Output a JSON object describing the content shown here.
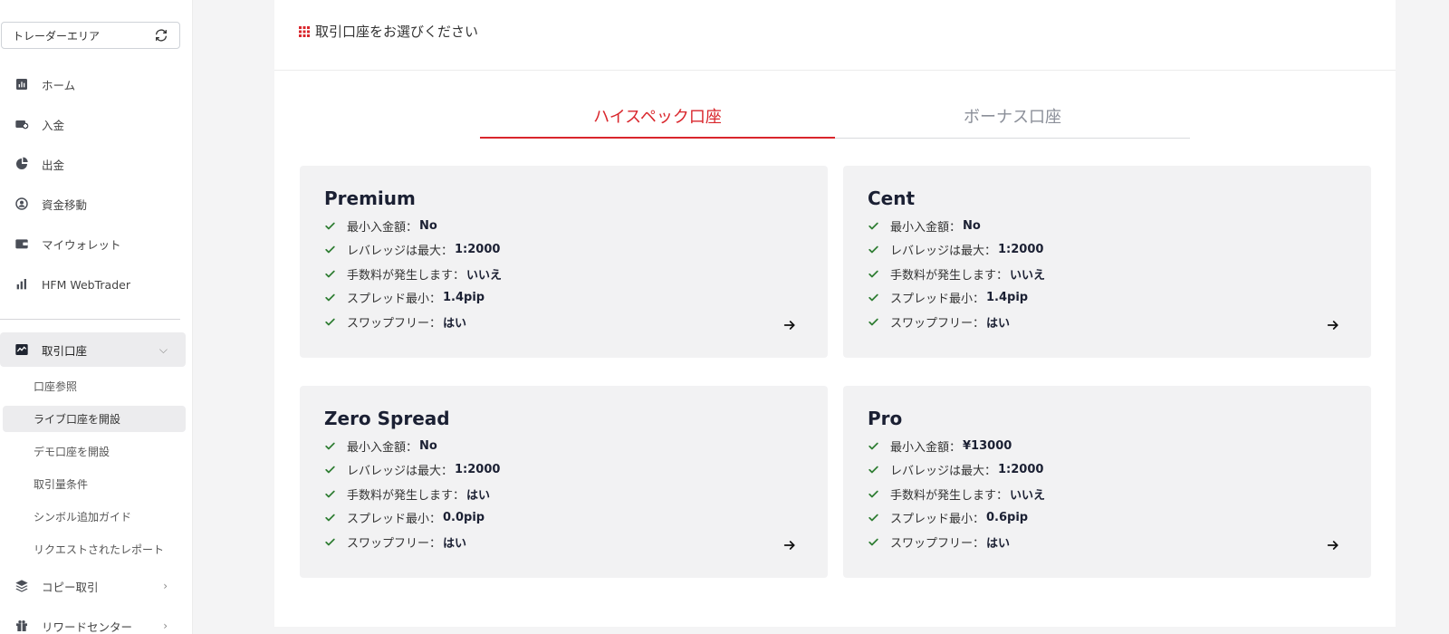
{
  "sidebar": {
    "area_label": "トレーダーエリア",
    "nav": [
      {
        "label": "ホーム",
        "icon": "chart-icon"
      },
      {
        "label": "入金",
        "icon": "deposit-icon"
      },
      {
        "label": "出金",
        "icon": "withdraw-icon"
      },
      {
        "label": "資金移動",
        "icon": "transfer-icon"
      },
      {
        "label": "マイウォレット",
        "icon": "wallet-icon"
      },
      {
        "label": "HFM WebTrader",
        "icon": "bars-icon"
      }
    ],
    "accounts": {
      "label": "取引口座",
      "icon": "trend-icon"
    },
    "sub": [
      "口座参照",
      "ライブ口座を開設",
      "デモ口座を開設",
      "取引量条件",
      "シンボル追加ガイド",
      "リクエストされたレポート"
    ],
    "copy": {
      "label": "コピー取引",
      "icon": "layers-icon"
    },
    "rewards": {
      "label": "リワードセンター",
      "icon": "gift-icon"
    }
  },
  "main": {
    "title": "取引口座をお選びください",
    "tabs": [
      "ハイスペック口座",
      "ボーナス口座"
    ],
    "active_tab": 0,
    "cards": [
      {
        "name": "Premium",
        "features": [
          {
            "label": "最小入金額：",
            "value": "No"
          },
          {
            "label": "レバレッジは最大：",
            "value": "1:2000"
          },
          {
            "label": "手数料が発生します：",
            "value": "いいえ"
          },
          {
            "label": "スプレッド最小：",
            "value": "1.4pip"
          },
          {
            "label": "スワップフリー：",
            "value": "はい"
          }
        ]
      },
      {
        "name": "Cent",
        "features": [
          {
            "label": "最小入金額：",
            "value": "No"
          },
          {
            "label": "レバレッジは最大：",
            "value": "1:2000"
          },
          {
            "label": "手数料が発生します：",
            "value": "いいえ"
          },
          {
            "label": "スプレッド最小：",
            "value": "1.4pip"
          },
          {
            "label": "スワップフリー：",
            "value": "はい"
          }
        ]
      },
      {
        "name": "Zero Spread",
        "features": [
          {
            "label": "最小入金額：",
            "value": "No"
          },
          {
            "label": "レバレッジは最大：",
            "value": "1:2000"
          },
          {
            "label": "手数料が発生します：",
            "value": "はい"
          },
          {
            "label": "スプレッド最小：",
            "value": "0.0pip"
          },
          {
            "label": "スワップフリー：",
            "value": "はい"
          }
        ]
      },
      {
        "name": "Pro",
        "features": [
          {
            "label": "最小入金額：",
            "value": "¥13000"
          },
          {
            "label": "レバレッジは最大：",
            "value": "1:2000"
          },
          {
            "label": "手数料が発生します：",
            "value": "いいえ"
          },
          {
            "label": "スプレッド最小：",
            "value": "0.6pip"
          },
          {
            "label": "スワップフリー：",
            "value": "はい"
          }
        ]
      }
    ]
  },
  "colors": {
    "accent": "#d9262c",
    "check": "#2e7d32",
    "card_bg": "#f2f2f3"
  }
}
